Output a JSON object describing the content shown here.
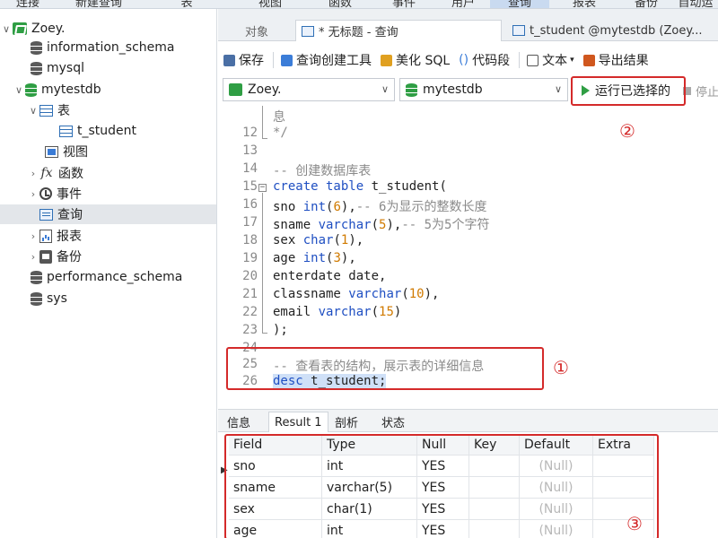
{
  "top_menu": {
    "items": [
      "连接",
      "新建查询",
      "表",
      "视图",
      "函数",
      "事件",
      "用户",
      "查询",
      "报表",
      "备份",
      "自动运"
    ],
    "active_index": 7
  },
  "sidebar": {
    "connection": "Zoey.",
    "items": [
      {
        "label": "information_schema",
        "icon": "database-icon"
      },
      {
        "label": "mysql",
        "icon": "database-icon"
      },
      {
        "label": "mytestdb",
        "icon": "database-icon"
      },
      {
        "label": "表",
        "icon": "table-icon"
      },
      {
        "label": "t_student",
        "icon": "table-icon"
      },
      {
        "label": "视图",
        "icon": "view-icon"
      },
      {
        "label": "函数",
        "icon": "function-icon"
      },
      {
        "label": "事件",
        "icon": "event-clock-icon"
      },
      {
        "label": "查询",
        "icon": "query-icon",
        "selected": true
      },
      {
        "label": "报表",
        "icon": "report-icon"
      },
      {
        "label": "备份",
        "icon": "backup-icon"
      },
      {
        "label": "performance_schema",
        "icon": "database-icon"
      },
      {
        "label": "sys",
        "icon": "database-icon"
      }
    ]
  },
  "tabs": {
    "objects": "对象",
    "active": "* 无标题 - 查询",
    "other": "t_student @mytestdb (Zoey..."
  },
  "toolbar": {
    "save": "保存",
    "query_builder": "查询创建工具",
    "beautify": "美化 SQL",
    "snippet": "代码段",
    "text": "文本",
    "export": "导出结果"
  },
  "selectbar": {
    "connection_value": "Zoey.",
    "database_value": "mytestdb",
    "run_selected": "运行已选择的",
    "stop": "停止"
  },
  "markers": {
    "m1": "①",
    "m2": "②",
    "m3": "③"
  },
  "editor": {
    "lines": [
      {
        "n": "",
        "text": "息"
      },
      {
        "n": "12",
        "text": "*/"
      },
      {
        "n": "13",
        "text": ""
      },
      {
        "n": "14",
        "text": "-- 创建数据库表"
      },
      {
        "n": "15",
        "text": "create table t_student("
      },
      {
        "n": "16",
        "text": "sno int(6),-- 6为显示的整数长度"
      },
      {
        "n": "17",
        "text": "sname varchar(5),-- 5为5个字符"
      },
      {
        "n": "18",
        "text": "sex char(1),"
      },
      {
        "n": "19",
        "text": "age int(3),"
      },
      {
        "n": "20",
        "text": "enterdate date,"
      },
      {
        "n": "21",
        "text": "classname varchar(10),"
      },
      {
        "n": "22",
        "text": "email varchar(15)"
      },
      {
        "n": "23",
        "text": ");"
      },
      {
        "n": "24",
        "text": ""
      },
      {
        "n": "25",
        "text": "-- 查看表的结构，展示表的详细信息"
      },
      {
        "n": "26",
        "text": "desc t_student;"
      }
    ]
  },
  "result_tabs": {
    "info": "信息",
    "result1": "Result 1",
    "profile": "剖析",
    "status": "状态"
  },
  "grid": {
    "columns": [
      "Field",
      "Type",
      "Null",
      "Key",
      "Default",
      "Extra"
    ],
    "rows": [
      [
        "sno",
        "int",
        "YES",
        "",
        "(Null)",
        ""
      ],
      [
        "sname",
        "varchar(5)",
        "YES",
        "",
        "(Null)",
        ""
      ],
      [
        "sex",
        "char(1)",
        "YES",
        "",
        "(Null)",
        ""
      ],
      [
        "age",
        "int",
        "YES",
        "",
        "(Null)",
        ""
      ]
    ]
  },
  "colors": {
    "accent_red": "#d42a2a",
    "keyword_blue": "#1f4fc2",
    "number_orange": "#d07a00",
    "comment_gray": "#8a8a8a",
    "run_green": "#2f9e44"
  }
}
